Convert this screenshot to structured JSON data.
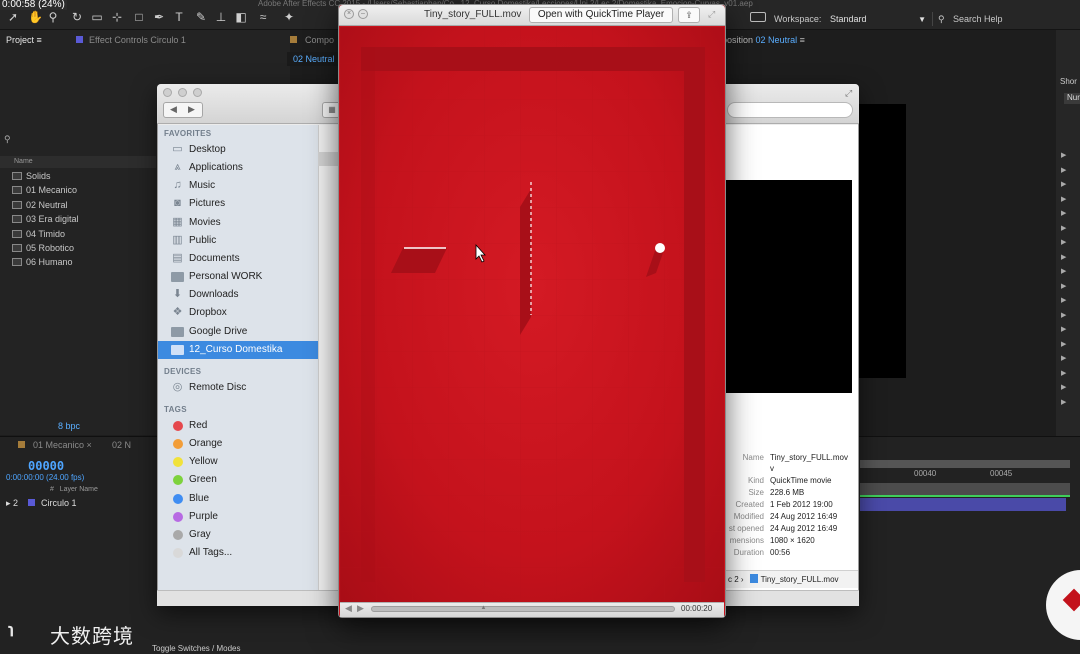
{
  "ae": {
    "timecode_overlay": "0:00:58 (24%)",
    "title": "Adobe After Effects CC 2015 - /Users/Sebastianbap/Co...12_Curso Domestika/Lecciones/Uni 2/Lec 2/Domestika_Emocion-Curvas_v01.aep",
    "workspace_label": "Workspace:",
    "workspace_value": "Standard",
    "search_help": "Search Help",
    "project_tab": "Project",
    "effect_controls_tab": "Effect Controls Circulo 1",
    "composition_tab": "Compo",
    "comp_subtab": "02 Neutral",
    "comp_tab_right_prefix": "position",
    "comp_tab_right_name": "02 Neutral",
    "project_column_name": "Name",
    "project_items": [
      "Solids",
      "01 Mecanico",
      "02 Neutral",
      "03 Era digital",
      "04 Timido",
      "05 Robotico",
      "06 Humano"
    ],
    "bpc": "8 bpc",
    "timeline_tab1": "01 Mecanico",
    "timeline_tab2": "02 N",
    "timeline_timecode": "00000",
    "timeline_fps": "0:00:00:00 (24.00 fps)",
    "layer_col_num": "#",
    "layer_col_name": "Layer Name",
    "layer_num": "2",
    "layer_name": "Circulo 1",
    "ruler_labels": [
      "00040",
      "00045"
    ],
    "toggle_switches": "Toggle Switches / Modes",
    "right_panel_label": "Shor",
    "right_panel_label2": "Nur"
  },
  "finder": {
    "favorites_heading": "FAVORITES",
    "favorites": [
      {
        "label": "Desktop",
        "icon": "desktop-icon"
      },
      {
        "label": "Applications",
        "icon": "applications-icon"
      },
      {
        "label": "Music",
        "icon": "music-icon"
      },
      {
        "label": "Pictures",
        "icon": "camera-icon"
      },
      {
        "label": "Movies",
        "icon": "film-icon"
      },
      {
        "label": "Public",
        "icon": "public-folder-icon"
      },
      {
        "label": "Documents",
        "icon": "documents-icon"
      },
      {
        "label": "Personal WORK",
        "icon": "folder-icon"
      },
      {
        "label": "Downloads",
        "icon": "downloads-icon"
      },
      {
        "label": "Dropbox",
        "icon": "dropbox-icon"
      },
      {
        "label": "Google Drive",
        "icon": "folder-icon"
      },
      {
        "label": "12_Curso Domestika",
        "icon": "folder-icon"
      }
    ],
    "selected_favorite": "12_Curso Domestika",
    "devices_heading": "DEVICES",
    "devices": [
      "Remote Disc"
    ],
    "tags_heading": "TAGS",
    "tags": [
      {
        "label": "Red",
        "color": "#e5484d"
      },
      {
        "label": "Orange",
        "color": "#f29d38"
      },
      {
        "label": "Yellow",
        "color": "#f1e23a"
      },
      {
        "label": "Green",
        "color": "#7dd23c"
      },
      {
        "label": "Blue",
        "color": "#3f8df2"
      },
      {
        "label": "Purple",
        "color": "#b76ae3"
      },
      {
        "label": "Gray",
        "color": "#a9a9a9"
      },
      {
        "label": "All Tags...",
        "color": "#d9d9d9"
      }
    ],
    "info": [
      {
        "key": "Name",
        "value": "Tiny_story_FULL.mov"
      },
      {
        "key": "Kind",
        "value": "QuickTime movie"
      },
      {
        "key": "Size",
        "value": "228.6 MB"
      },
      {
        "key": "Created",
        "value": "1 Feb 2012 19:00"
      },
      {
        "key": "Modified",
        "value": "24 Aug 2012 16:49"
      },
      {
        "key": "st opened",
        "value": "24 Aug 2012 16:49"
      },
      {
        "key": "mensions",
        "value": "1080 × 1620"
      },
      {
        "key": "Duration",
        "value": "00:56"
      }
    ],
    "name_value_line2": "v",
    "path_prefix": "c 2",
    "path_file": "Tiny_story_FULL.mov"
  },
  "quicktime": {
    "title": "Tiny_story_FULL.mov",
    "open_button": "Open with QuickTime Player",
    "current_time": "00:00:20",
    "progress": 0.37,
    "colors": {
      "background": "#c9131d",
      "shape": "#a80f18",
      "white": "#ffffff"
    }
  },
  "watermark": {
    "logo": "℩",
    "text": "大数跨境"
  }
}
